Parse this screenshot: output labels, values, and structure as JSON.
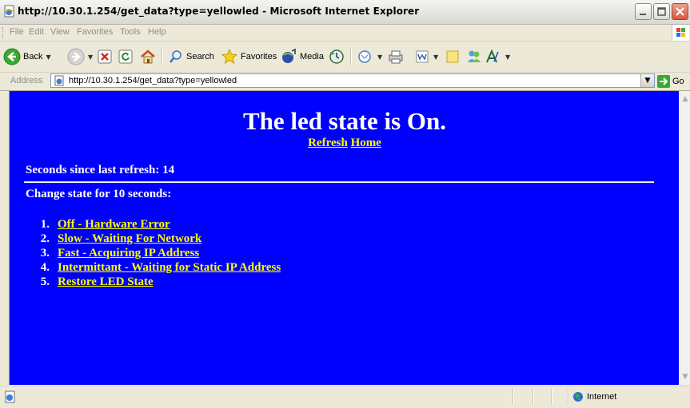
{
  "window": {
    "title": "http://10.30.1.254/get_data?type=yellowled - Microsoft Internet Explorer"
  },
  "menu": [
    "File",
    "Edit",
    "View",
    "Favorites",
    "Tools",
    "Help"
  ],
  "toolbar": {
    "back_label": "Back",
    "search_label": "Search",
    "favorites_label": "Favorites",
    "media_label": "Media"
  },
  "address": {
    "label": "Address",
    "url": "http://10.30.1.254/get_data?type=yellowled",
    "go_label": "Go"
  },
  "page": {
    "heading": "The led state is On.",
    "refresh_link": "Refresh",
    "home_link": "Home",
    "seconds_text": "Seconds since last refresh: 14",
    "change_text": "Change state for 10 seconds:",
    "options": [
      {
        "num": "1.",
        "label": "Off - Hardware Error"
      },
      {
        "num": "2.",
        "label": "Slow - Waiting For Network"
      },
      {
        "num": "3.",
        "label": "Fast - Acquiring IP Address"
      },
      {
        "num": "4.",
        "label": "Intermittant - Waiting for Static IP Address"
      },
      {
        "num": "5.",
        "label": "Restore LED State"
      }
    ],
    "background_color": "#0000ff",
    "link_color": "#ffff00"
  },
  "status": {
    "zone_label": "Internet"
  }
}
